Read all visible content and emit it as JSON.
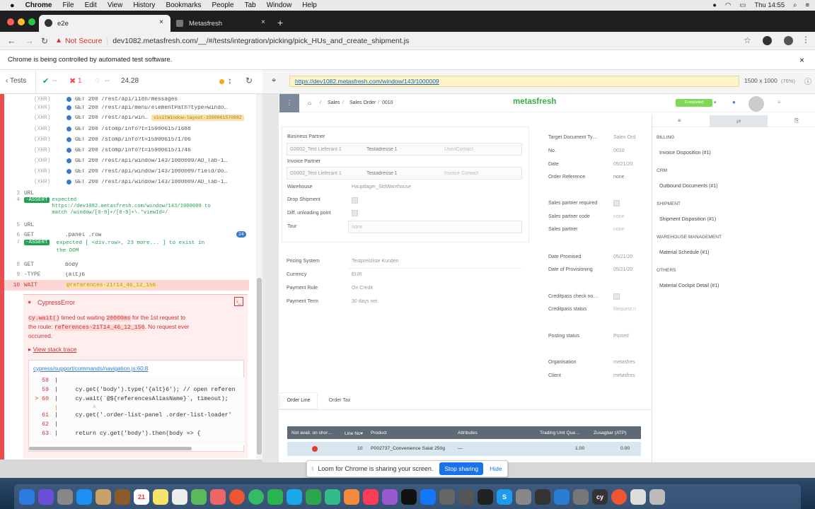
{
  "menubar": {
    "apple": "",
    "items": [
      "Chrome",
      "File",
      "Edit",
      "View",
      "History",
      "Bookmarks",
      "People",
      "Tab",
      "Window",
      "Help"
    ],
    "clock": "Thu 14:55"
  },
  "tabs": [
    {
      "title": "e2e",
      "close": "×"
    },
    {
      "title": "Metasfresh",
      "close": "×"
    }
  ],
  "new_tab": "+",
  "address": {
    "security": "Not Secure",
    "url": "dev1082.metasfresh.com/__/#/tests/integration/picking/pick_HUs_and_create_shipment.js"
  },
  "infobar": {
    "text": "Chrome is being controlled by automated test software.",
    "close": "×"
  },
  "cypress": {
    "back_label": "Tests",
    "passed": "--",
    "failed": "1",
    "pending": "--",
    "duration": "24.28",
    "commands": [
      {
        "n": "",
        "name": "(XHR)",
        "msg": "GET 200 /rest/api/i18n/messages"
      },
      {
        "n": "",
        "name": "(XHR)",
        "msg": "GET 200 /rest/api/menu/elementPath?type=windo…"
      },
      {
        "n": "",
        "name": "(XHR)",
        "msg": "GET 200 /rest/api/win…",
        "alias": "visitWindow-layout-1590061570882"
      },
      {
        "n": "",
        "name": "(XHR)",
        "msg": "GET 200 /stomp/info?t=1590061571688"
      },
      {
        "n": "",
        "name": "(XHR)",
        "msg": "GET 200 /stomp/info?t=1590061571706"
      },
      {
        "n": "",
        "name": "(XHR)",
        "msg": "GET 200 /stomp/info?t=1590061571746"
      },
      {
        "n": "",
        "name": "(XHR)",
        "msg": "GET 200 /rest/api/window/143/1000009/AD_Tab-1…"
      },
      {
        "n": "",
        "name": "(XHR)",
        "msg": "GET 200 /rest/api/window/143/1000009/field/Do…"
      },
      {
        "n": "",
        "name": "(XHR)",
        "msg": "GET 200 /rest/api/window/143/1000009/AD_Tab-1…"
      }
    ],
    "steps": [
      {
        "n": "3",
        "name": "URL",
        "msg": ""
      },
      {
        "n": "4",
        "name": "-ASSERT",
        "msg": "expected https://dev1082.metasfresh.com/window/143/1000009 to match /window/[0-9]+/[0-9]+\\.*viewId=/"
      },
      {
        "n": "5",
        "name": "URL",
        "msg": ""
      },
      {
        "n": "6",
        "name": "GET",
        "msg": ".panel .row",
        "badge": "24"
      },
      {
        "n": "7",
        "name": "-ASSERT",
        "msg": "expected [ <div.row>, 23 more... ] to exist in the DOM"
      },
      {
        "n": "8",
        "name": "GET",
        "msg": "body"
      },
      {
        "n": "9",
        "name": "-TYPE",
        "msg": "{alt}6"
      },
      {
        "n": "10",
        "name": "WAIT",
        "msg": "@references-21T14_46_12_156"
      }
    ],
    "assert4_a": "expected",
    "assert4_b": "https://dev1082.metasfresh.com/window/143/1000009 to",
    "assert4_c": "match /window/[0-9]+/[0-9]+\\.*viewId=/",
    "assert7_a": "expected [ <div.row>, 23 more... ] to exist in",
    "assert7_b": "the DOM",
    "error": {
      "title": "CypressError",
      "line1_a": "cy.wait()",
      "line1_b": "timed out waiting",
      "line1_c": "20000ms",
      "line1_d": "for the 1st request to",
      "line2_a": "the route:",
      "line2_b": "references-21T14_46_12_156",
      "line2_c": ". No request ever",
      "line3": "occurred.",
      "stack_toggle": "View stack trace",
      "file": "cypress/support/commands/navigation.js:60:8",
      "code": [
        {
          "ln": "58",
          "code": "|"
        },
        {
          "ln": "59",
          "code": "|     cy.get('body').type('{alt}6'); // open referen"
        },
        {
          "ln": "> 60",
          "code": "|     cy.wait(`@${referencesAliasName}`, timeout);"
        },
        {
          "ln": "",
          "code": "|          ^"
        },
        {
          "ln": "61",
          "code": "|     cy.get('.order-list-panel .order-list-loader'"
        },
        {
          "ln": "62",
          "code": "|"
        },
        {
          "ln": "63",
          "code": "|     return cy.get('body').then(body => {"
        }
      ]
    }
  },
  "preview": {
    "url": "https://dev1082.metasfresh.com/window/143/1000009",
    "size": "1500 x 1000",
    "zoom": "(76%)"
  },
  "metasfresh": {
    "breadcrumb": [
      "Sales",
      "Sales Order",
      "0010"
    ],
    "logo": "metasfresh",
    "status": "Completed",
    "left": {
      "bp_label": "Business Partner",
      "bp_value": "G0002_Test Lieferant 1",
      "bp_addr": "Testadresse 1",
      "bp_contact": "User/Contact",
      "ip_label": "Invoice Partner",
      "ip_value": "G0002_Test Lieferant 1",
      "ip_addr": "Testadresse 1",
      "ip_contact": "Invoice Contact",
      "wh_label": "Warehouse",
      "wh_value": "Hauptlager_StdWarehouse",
      "drop_label": "Drop Shipment",
      "diff_label": "Diff. unloading point",
      "tour_label": "Tour",
      "tour_value": "none",
      "price_label": "Pricing System",
      "price_value": "Testpreisliste Kunden",
      "cur_label": "Currency",
      "cur_value": "EUR",
      "pr_label": "Payment Rule",
      "pr_value": "On Credit",
      "pt_label": "Payment Term",
      "pt_value": "30 days net"
    },
    "right": {
      "tdt": "Target Document Ty…",
      "tdt_v": "Sales Ord",
      "no": "No.",
      "no_v": "0010",
      "date": "Date",
      "date_v": "05/21/20",
      "oref": "Order Reference",
      "oref_v": "none",
      "spr": "Sales partner required",
      "spc": "Sales partner code",
      "spc_v": "none",
      "sp": "Sales partner",
      "sp_v": "none",
      "dp": "Date Promised",
      "dp_v": "05/21/20",
      "dop": "Date of Provisioning",
      "dop_v": "05/21/20",
      "cc": "Creditpass check no…",
      "cs": "Creditpass status",
      "cs_v": "Request n",
      "ps": "Posting status",
      "ps_v": "Posted",
      "org": "Organisation",
      "org_v": "metasfres",
      "client": "Client",
      "client_v": "metasfres"
    },
    "tabs": [
      "Order Line",
      "Order Tax"
    ],
    "grid": {
      "headers": [
        "Not avail. on shor…",
        "Line No▾",
        "Product",
        "Attributes",
        "Trading Unit Qua…",
        "Zusagbar (ATP)"
      ],
      "row": {
        "line": "10",
        "product": "P002737_Convenience Salat 250g",
        "attr": "—",
        "qty": "1.00",
        "atp": "0.00"
      }
    },
    "side": [
      {
        "head": "BILLING",
        "item": "Invoice Disposition (#1)"
      },
      {
        "head": "CRM",
        "item": "Outbound Documents (#1)"
      },
      {
        "head": "SHIPMENT",
        "item": "Shipment Disposition (#1)"
      },
      {
        "head": "WAREHOUSE MANAGEMENT",
        "item": "Material Schedule (#1)"
      },
      {
        "head": "OTHERS",
        "item": "Material Cockpit Detail (#1)"
      }
    ]
  },
  "loom": {
    "text": "Loom for Chrome is sharing your screen.",
    "stop": "Stop sharing",
    "hide": "Hide"
  },
  "colors": {
    "fail": "#e94f4f",
    "pass": "#21a153",
    "link": "#1862b6",
    "metasfresh": "#3ab03e"
  }
}
